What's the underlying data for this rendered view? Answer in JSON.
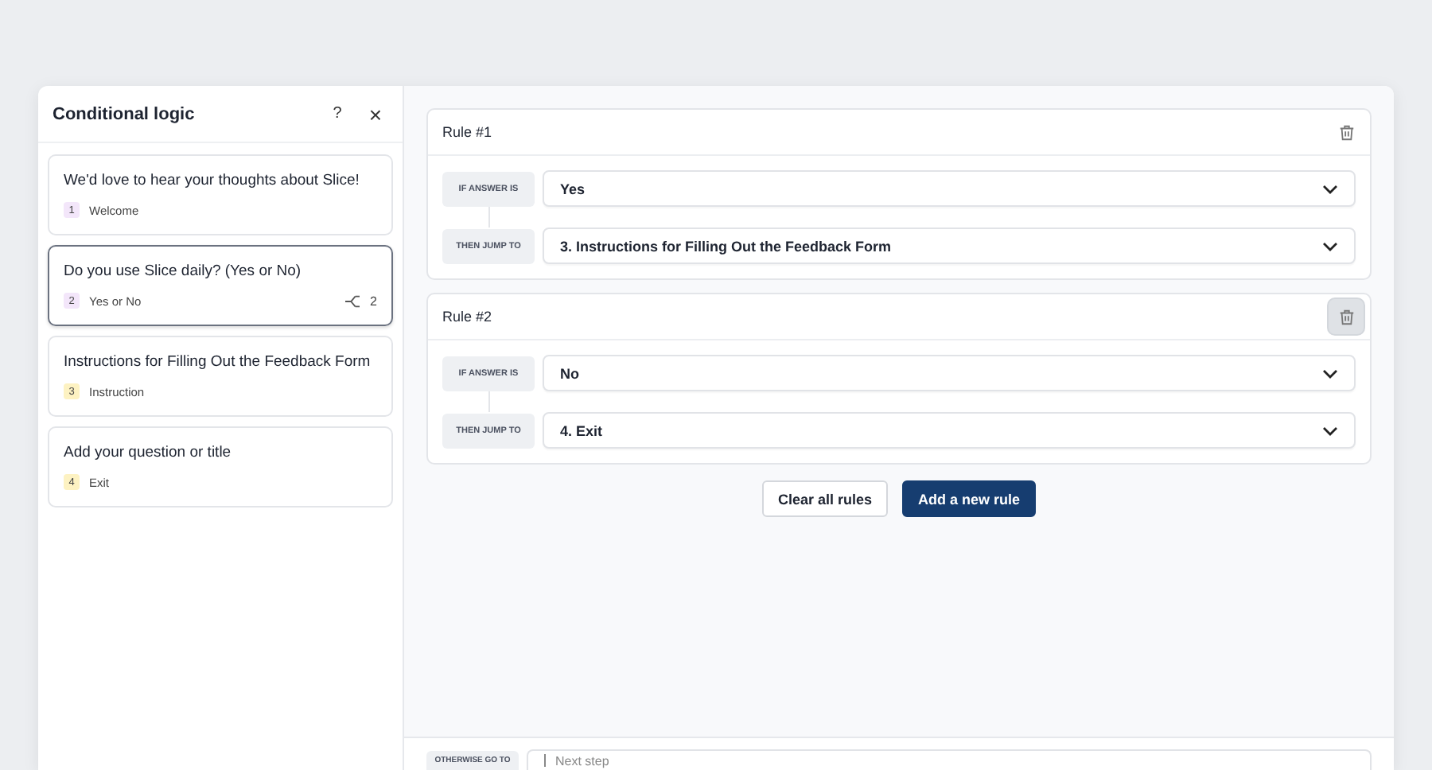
{
  "modal": {
    "title": "Conditional logic",
    "help_label": "?",
    "close_label": "×"
  },
  "steps": [
    {
      "title": "We'd love to hear your thoughts about Slice!",
      "number": "1",
      "type": "Welcome",
      "color": "#f3e6fa",
      "selected": false
    },
    {
      "title": "Do you use Slice daily? (Yes or No)",
      "number": "2",
      "type": "Yes or No",
      "color": "#f3e6fa",
      "selected": true,
      "branch_count": "2"
    },
    {
      "title": "Instructions for Filling Out the Feedback Form",
      "number": "3",
      "type": "Instruction",
      "color": "#fdf2c2",
      "selected": false
    },
    {
      "title": "Add your question or title",
      "number": "4",
      "type": "Exit",
      "color": "#fdf2c2",
      "selected": false
    }
  ],
  "rules": [
    {
      "title": "Rule #1",
      "delete_highlighted": false,
      "if_label": "IF ANSWER IS",
      "if_value": "Yes",
      "then_label": "THEN JUMP TO",
      "then_value": "3. Instructions for Filling Out the Feedback Form"
    },
    {
      "title": "Rule #2",
      "delete_highlighted": true,
      "if_label": "IF ANSWER IS",
      "if_value": "No",
      "then_label": "THEN JUMP TO",
      "then_value": "4. Exit"
    }
  ],
  "buttons": {
    "clear": "Clear all rules",
    "add": "Add a new rule"
  },
  "otherwise": {
    "label": "OTHERWISE GO TO",
    "placeholder": "Next step"
  }
}
